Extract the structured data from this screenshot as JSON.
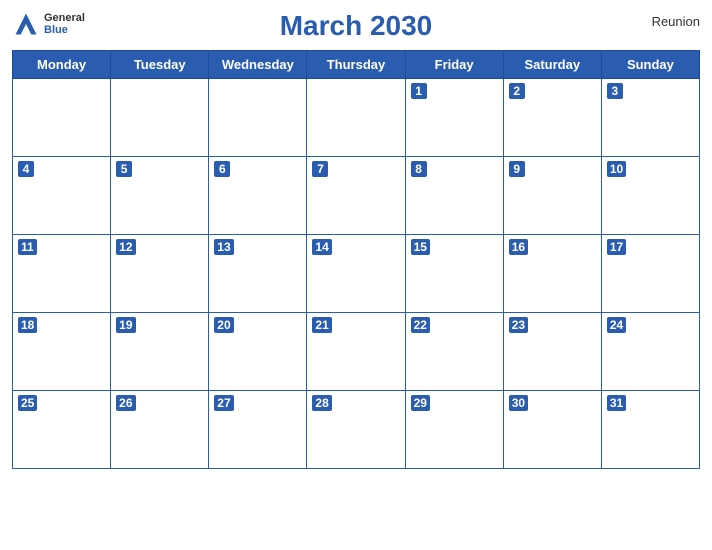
{
  "header": {
    "title": "March 2030",
    "region": "Reunion",
    "logo_general": "General",
    "logo_blue": "Blue"
  },
  "weekdays": [
    "Monday",
    "Tuesday",
    "Wednesday",
    "Thursday",
    "Friday",
    "Saturday",
    "Sunday"
  ],
  "weeks": [
    [
      null,
      null,
      null,
      null,
      1,
      2,
      3
    ],
    [
      4,
      5,
      6,
      7,
      8,
      9,
      10
    ],
    [
      11,
      12,
      13,
      14,
      15,
      16,
      17
    ],
    [
      18,
      19,
      20,
      21,
      22,
      23,
      24
    ],
    [
      25,
      26,
      27,
      28,
      29,
      30,
      31
    ]
  ]
}
